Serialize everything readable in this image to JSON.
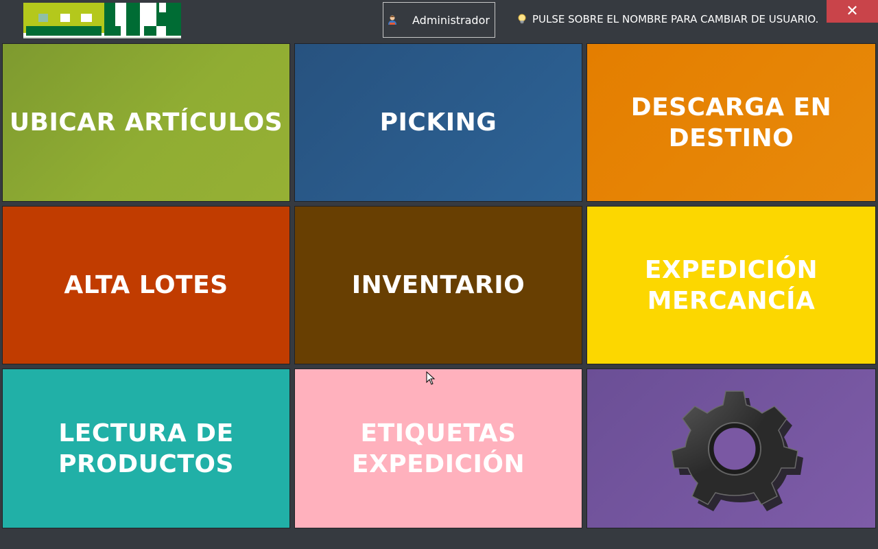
{
  "header": {
    "user_label": "Administrador",
    "hint_text": "PULSE SOBRE EL NOMBRE PARA CAMBIAR DE USUARIO.",
    "close_label": "✕"
  },
  "tiles": [
    {
      "label": "UBICAR ARTÍCULOS",
      "color": "#8ba831"
    },
    {
      "label": "PICKING",
      "color": "#2a5d8c"
    },
    {
      "label": "DESCARGA EN\nDESTINO",
      "color": "#e68400"
    },
    {
      "label": "ALTA LOTES",
      "color": "#c13c00"
    },
    {
      "label": "INVENTARIO",
      "color": "#683f02"
    },
    {
      "label": "EXPEDICIÓN\nMERCANCÍA",
      "color": "#fcd700"
    },
    {
      "label": "LECTURA DE\nPRODUCTOS",
      "color": "#21b0a7"
    },
    {
      "label": "ETIQUETAS\nEXPEDICIÓN",
      "color": "#ffb1bd"
    },
    {
      "label": "",
      "color": "#7a58a3",
      "icon": "gear-icon"
    }
  ]
}
